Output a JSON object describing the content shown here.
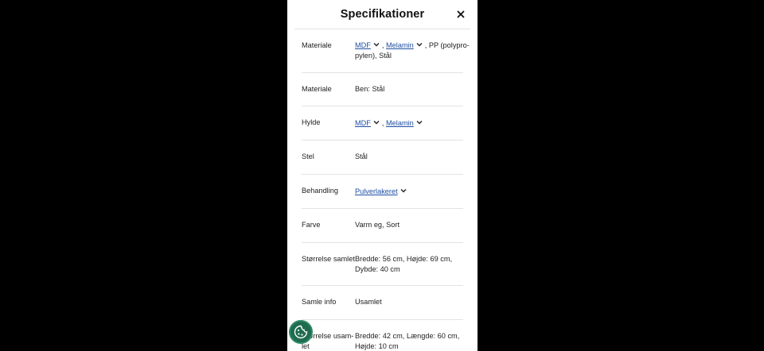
{
  "colors": {
    "backdrop": "#000000",
    "panel": "#ffffff",
    "link": "#1f4fa3",
    "divider": "#e3e3e3",
    "cookie_button": "#1e6b50"
  },
  "header": {
    "title": "Specifikationer",
    "close_icon": "close-icon"
  },
  "rows": [
    {
      "label": "Materiale",
      "links": [
        "MDF",
        "Melamin"
      ],
      "separator": ",",
      "suffix_1": ", PP (polypro-",
      "suffix_2": "pylen), Stål"
    },
    {
      "label": "Materiale",
      "value": "Ben: Stål"
    },
    {
      "label": "Hylde",
      "links": [
        "MDF",
        "Melamin"
      ],
      "separator": ","
    },
    {
      "label": "Stel",
      "value": "Stål"
    },
    {
      "label": "Behandling",
      "links": [
        "Pulverlakeret"
      ]
    },
    {
      "label": "Farve",
      "value": "Varm eg, Sort"
    },
    {
      "label": "Størrelse samlet",
      "value_1": "Bredde: 56 cm, Højde: 69 cm,",
      "value_2": "Dybde: 40 cm"
    },
    {
      "label": "Samle info",
      "value": "Usamlet"
    },
    {
      "label_1": "Størrelse usam-",
      "label_2": "let",
      "value_1": "Bredde: 42 cm, Længde: 60 cm,",
      "value_2": "Højde: 10 cm"
    }
  ],
  "cookie_button": {
    "icon": "cookie-icon"
  }
}
